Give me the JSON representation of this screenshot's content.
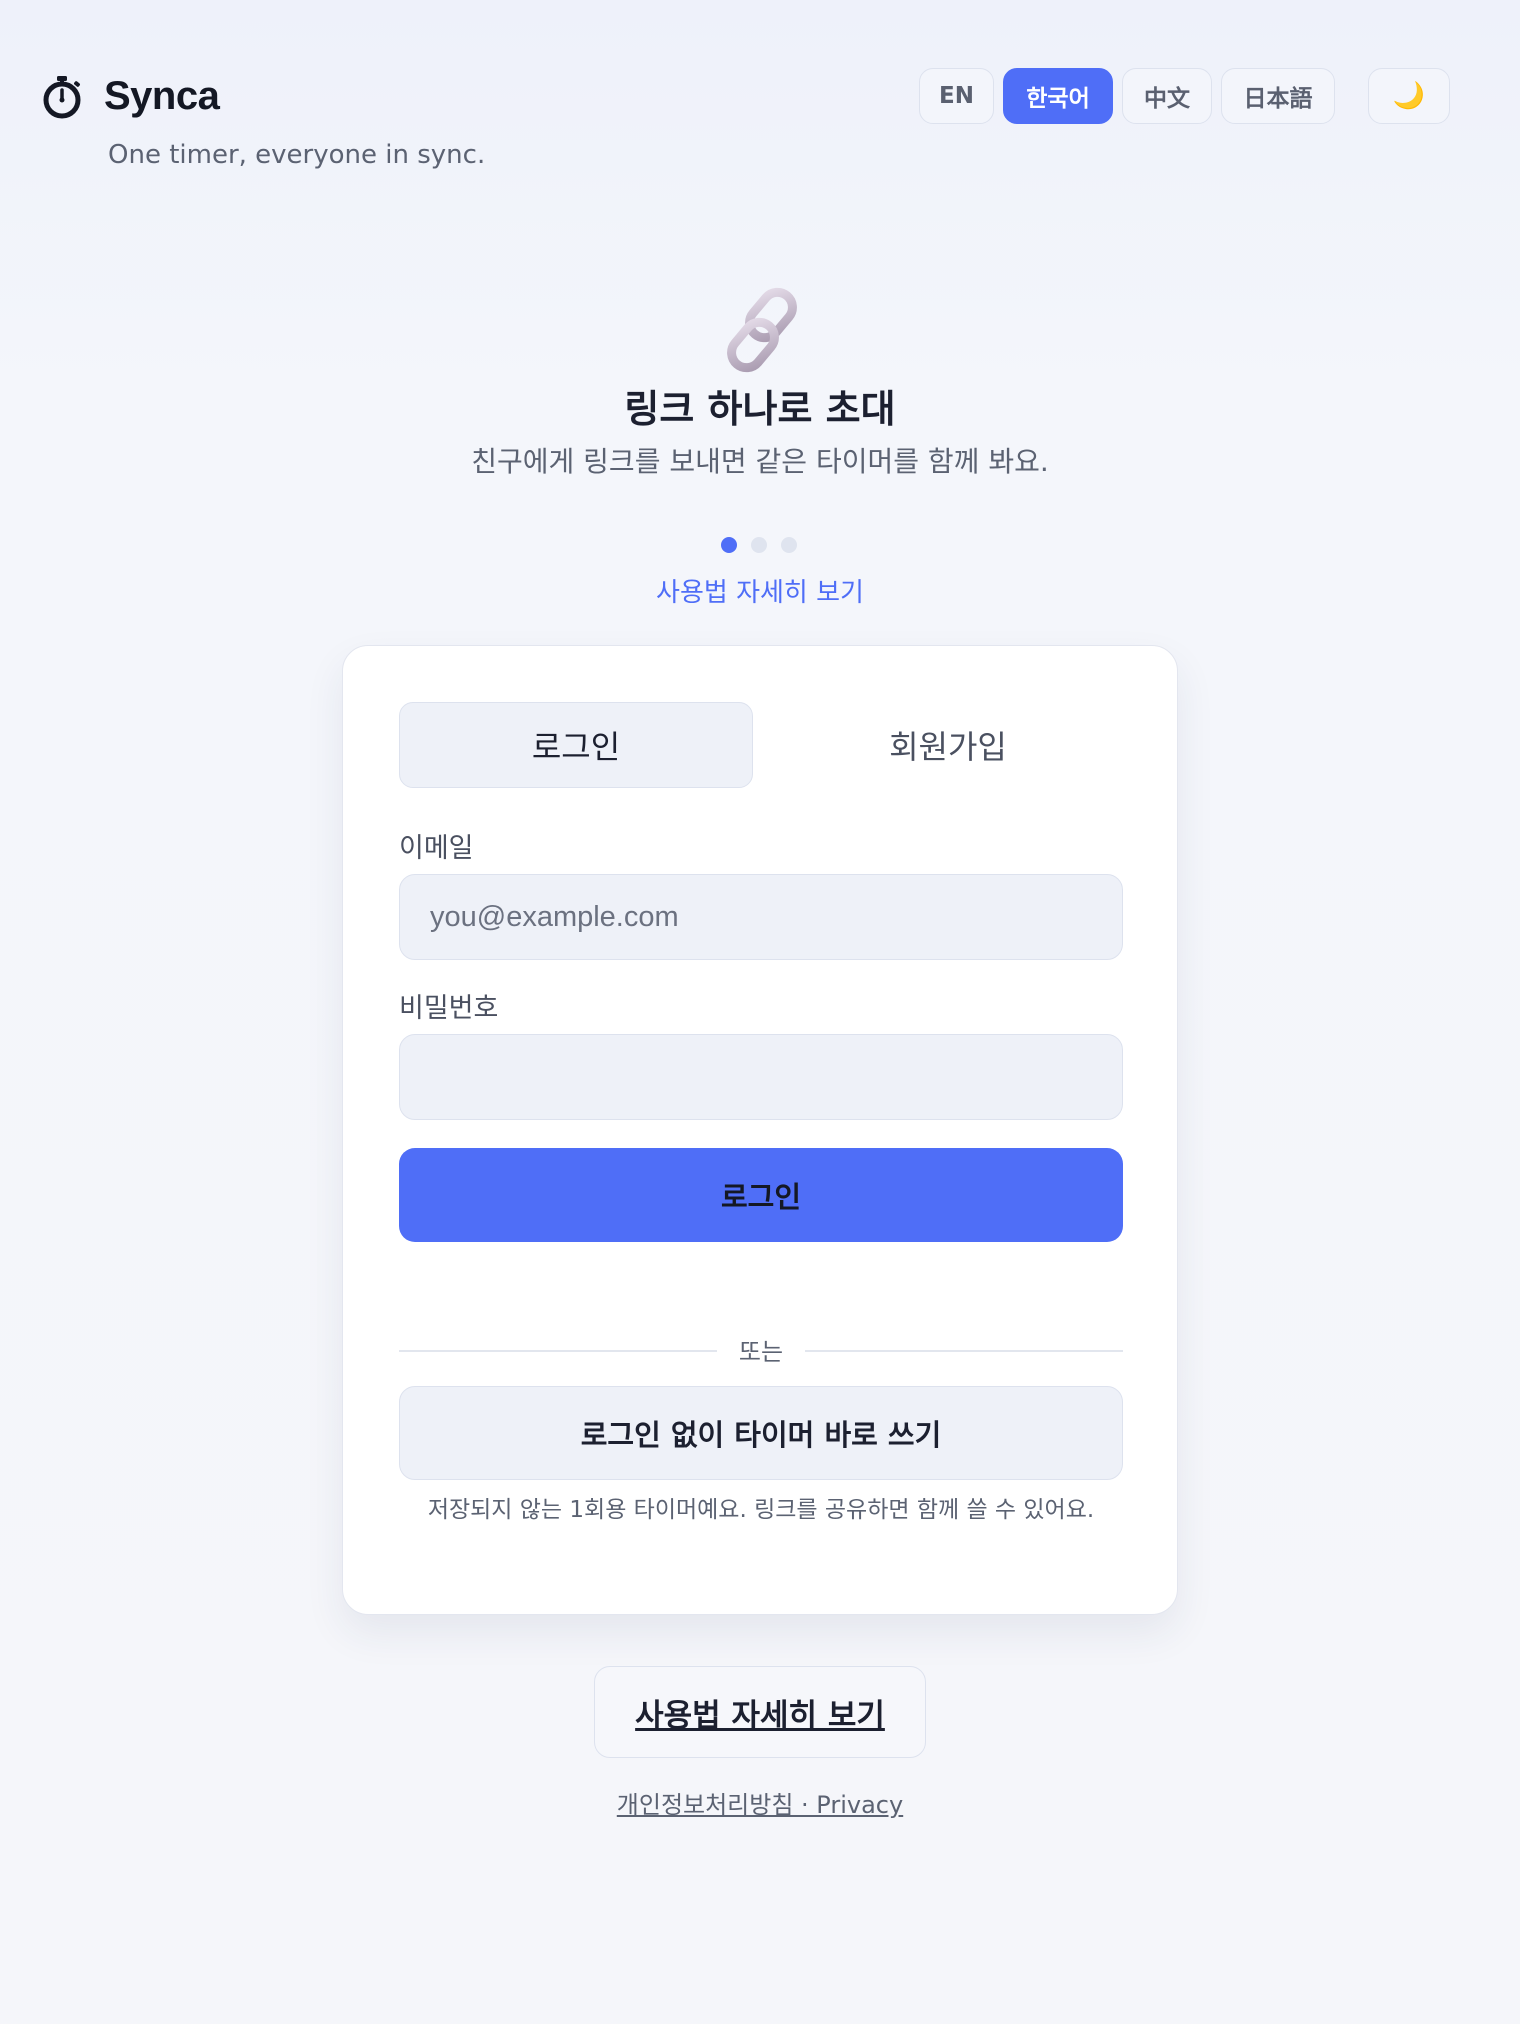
{
  "header": {
    "app_name": "Synca",
    "tagline": "One timer, everyone in sync.",
    "logo_icon": "stopwatch-icon"
  },
  "languages": {
    "items": [
      "EN",
      "한국어",
      "中文",
      "日本語"
    ],
    "selected": "한국어",
    "theme_toggle_icon": "🌙"
  },
  "hero": {
    "icon": "🔗",
    "title": "링크 하나로 초대",
    "subtitle": "친구에게 링크를 보내면 같은 타이머를 함께 봐요.",
    "carousel_total": 3,
    "carousel_active": 1,
    "guide_link": "사용법 자세히 보기"
  },
  "auth": {
    "tabs": [
      "로그인",
      "회원가입"
    ],
    "active_tab": "로그인",
    "email_label": "이메일",
    "email_placeholder": "you@example.com",
    "email_value": "",
    "password_label": "비밀번호",
    "password_value": "",
    "submit_label": "로그인",
    "divider_text": "또는",
    "guest_label": "로그인 없이 타이머 바로 쓰기",
    "guest_note": "저장되지 않는 1회용 타이머예요. 링크를 공유하면 함께 쓸 수 있어요."
  },
  "footer": {
    "guide_button": "사용법 자세히 보기",
    "privacy_link": "개인정보처리방침 · Privacy"
  },
  "colors": {
    "accent": "#4f6ef7",
    "background": "#f5f6fa",
    "card": "#ffffff",
    "input_bg": "#eef1f8",
    "muted_text": "#5b6272"
  }
}
